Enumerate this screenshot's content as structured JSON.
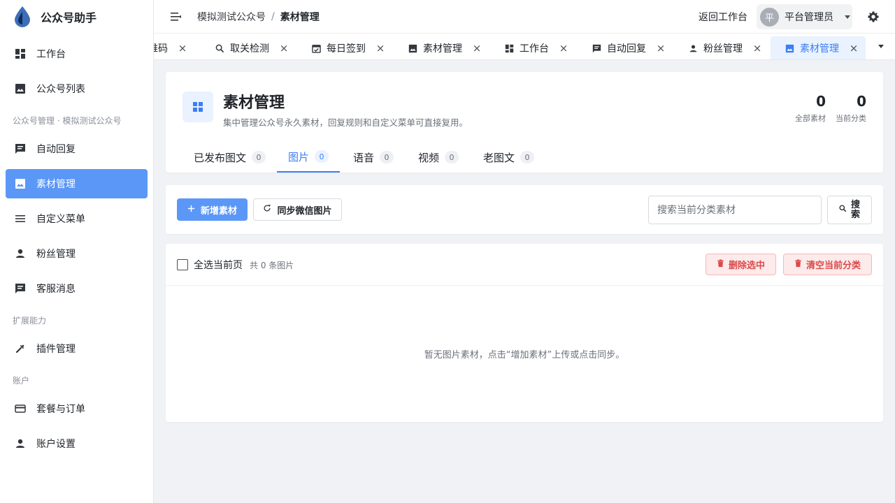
{
  "brand": {
    "name": "公众号助手",
    "logo_color": "#3d6fb8"
  },
  "sidebar": {
    "items": [
      {
        "label": "工作台",
        "icon": "dashboard-icon"
      },
      {
        "label": "公众号列表",
        "icon": "image-icon"
      },
      {
        "label": "自动回复",
        "icon": "message-icon"
      },
      {
        "label": "素材管理",
        "icon": "image-icon",
        "active": true
      },
      {
        "label": "自定义菜单",
        "icon": "menu-icon"
      },
      {
        "label": "粉丝管理",
        "icon": "person-icon"
      },
      {
        "label": "客服消息",
        "icon": "message-icon"
      },
      {
        "label": "插件管理",
        "icon": "plugin-icon"
      },
      {
        "label": "套餐与订单",
        "icon": "card-icon"
      },
      {
        "label": "账户设置",
        "icon": "person-icon"
      }
    ],
    "sections": [
      "公众号管理 · 模拟测试公众号",
      "扩展能力",
      "账户"
    ]
  },
  "header": {
    "breadcrumb": [
      "模拟测试公众号",
      "素材管理"
    ],
    "separator": "/",
    "back_link": "返回工作台",
    "user": {
      "avatar_text": "平",
      "name": "平台管理员"
    }
  },
  "tabs": [
    {
      "label": "维码",
      "icon": "",
      "active": false
    },
    {
      "label": "取关检测",
      "icon": "search-icon",
      "active": false
    },
    {
      "label": "每日签到",
      "icon": "calendar-check-icon",
      "active": false
    },
    {
      "label": "素材管理",
      "icon": "image-icon",
      "active": false
    },
    {
      "label": "工作台",
      "icon": "dashboard-icon",
      "active": false
    },
    {
      "label": "自动回复",
      "icon": "message-icon",
      "active": false
    },
    {
      "label": "粉丝管理",
      "icon": "person-icon",
      "active": false
    },
    {
      "label": "素材管理",
      "icon": "image-icon",
      "active": true
    }
  ],
  "page": {
    "title": "素材管理",
    "description": "集中管理公众号永久素材，回复规则和自定义菜单可直接复用。",
    "stats": [
      {
        "value": "0",
        "label": "全部素材"
      },
      {
        "value": "0",
        "label": "当前分类"
      }
    ],
    "categories": [
      {
        "label": "已发布图文",
        "count": "0"
      },
      {
        "label": "图片",
        "count": "0",
        "active": true
      },
      {
        "label": "语音",
        "count": "0"
      },
      {
        "label": "视频",
        "count": "0"
      },
      {
        "label": "老图文",
        "count": "0"
      }
    ]
  },
  "toolbar": {
    "add_label": "新增素材",
    "sync_label": "同步微信图片",
    "search_placeholder": "搜索当前分类素材",
    "search_value": "",
    "search_button": "搜索"
  },
  "list": {
    "select_all_label": "全选当前页",
    "count_text": "共 0 条图片",
    "delete_selected": "删除选中",
    "clear_category": "清空当前分类",
    "empty_text": "暂无图片素材，点击“增加素材”上传或点击同步。"
  },
  "colors": {
    "primary": "#5b97f7",
    "active_text": "#3d7ef2",
    "danger": "#d94a4a",
    "danger_bg": "#fdeaea"
  }
}
